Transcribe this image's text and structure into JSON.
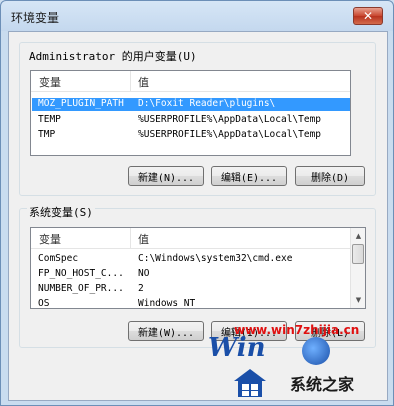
{
  "window": {
    "title": "环境变量",
    "close_glyph": "✕"
  },
  "user_vars": {
    "group_label": "Administrator 的用户变量(U)",
    "columns": [
      "变量",
      "值"
    ],
    "rows": [
      {
        "name": "MOZ_PLUGIN_PATH",
        "value": "D:\\Foxit Reader\\plugins\\",
        "selected": true
      },
      {
        "name": "TEMP",
        "value": "%USERPROFILE%\\AppData\\Local\\Temp",
        "selected": false
      },
      {
        "name": "TMP",
        "value": "%USERPROFILE%\\AppData\\Local\\Temp",
        "selected": false
      }
    ],
    "buttons": {
      "new": "新建(N)...",
      "edit": "编辑(E)...",
      "delete": "删除(D)"
    }
  },
  "system_vars": {
    "group_label": "系统变量(S)",
    "columns": [
      "变量",
      "值"
    ],
    "rows": [
      {
        "name": "ComSpec",
        "value": "C:\\Windows\\system32\\cmd.exe"
      },
      {
        "name": "FP_NO_HOST_C...",
        "value": "NO"
      },
      {
        "name": "NUMBER_OF_PR...",
        "value": "2"
      },
      {
        "name": "OS",
        "value": "Windows_NT"
      }
    ],
    "buttons": {
      "new": "新建(W)...",
      "edit": "编辑(I)...",
      "delete": "删除(L)"
    },
    "scroll_up": "▲",
    "scroll_down": "▼"
  },
  "watermark": {
    "url": "www.win7zhijia.cn",
    "brand_prefix": "Win",
    "name": "系统之家",
    "accent": "#1a4fa8",
    "url_color": "#e01010"
  }
}
